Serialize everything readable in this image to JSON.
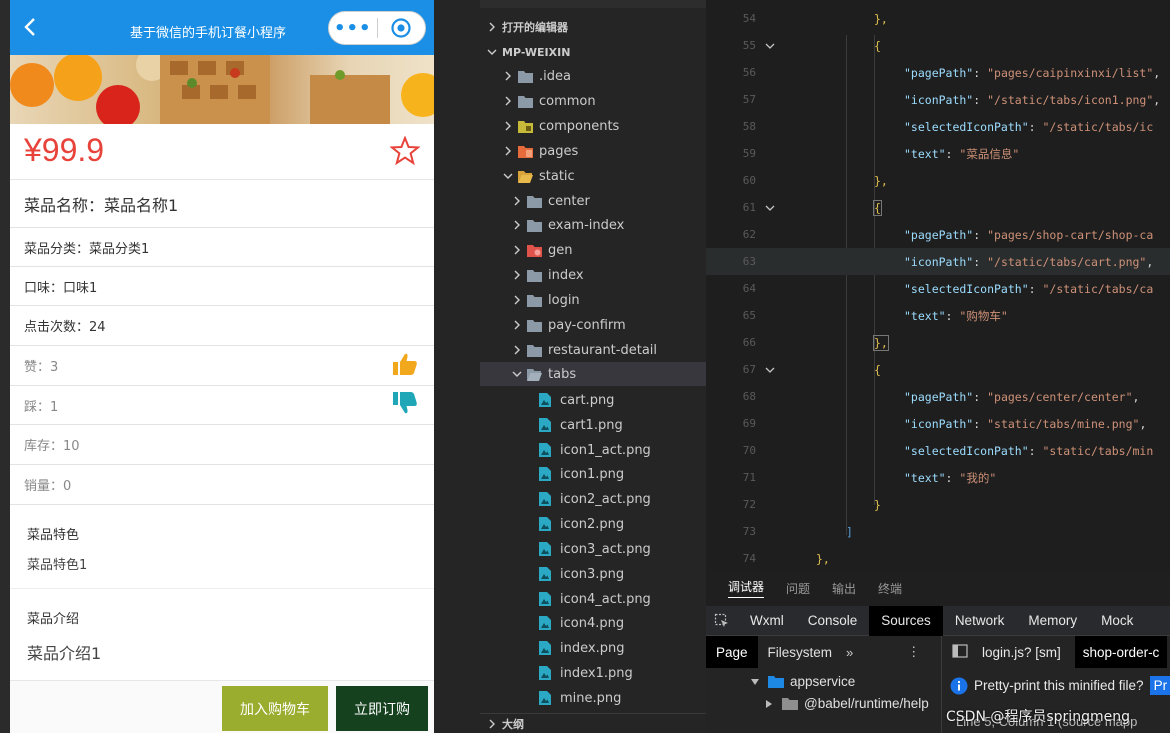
{
  "phone": {
    "title": "基于微信的手机订餐小程序",
    "capsule_more": "•••",
    "price": "¥99.9",
    "name_row": "菜品名称：菜品名称1",
    "rows": [
      {
        "label": "菜品分类：菜品分类1"
      },
      {
        "label": "口味：口味1"
      },
      {
        "label": "点击次数：24"
      },
      {
        "label": "赞：3"
      },
      {
        "label": "踩：1"
      },
      {
        "label": "库存：10"
      },
      {
        "label": "销量：0"
      }
    ],
    "feature_title": "菜品特色",
    "feature_text": "菜品特色1",
    "intro_title": "菜品介绍",
    "intro_text": "菜品介绍1",
    "add_cart": "加入购物车",
    "order_now": "立即订购"
  },
  "explorer": {
    "open_editors": "打开的编辑器",
    "project": "MP-WEIXIN",
    "folders": [
      ".idea",
      "common",
      "components",
      "pages",
      "static"
    ],
    "static_children": [
      "center",
      "exam-index",
      "gen",
      "index",
      "login",
      "pay-confirm",
      "restaurant-detail",
      "tabs"
    ],
    "tab_files": [
      "cart.png",
      "cart1.png",
      "icon1_act.png",
      "icon1.png",
      "icon2_act.png",
      "icon2.png",
      "icon3_act.png",
      "icon3.png",
      "icon4_act.png",
      "icon4.png",
      "index.png",
      "index1.png",
      "mine.png"
    ],
    "outline": "大纲"
  },
  "editor": {
    "line_numbers": [
      "54",
      "55",
      "56",
      "57",
      "58",
      "59",
      "60",
      "61",
      "62",
      "63",
      "64",
      "65",
      "66",
      "67",
      "68",
      "69",
      "70",
      "71",
      "72",
      "73",
      "74"
    ],
    "open_brace": "{",
    "close_brace_comma": "},",
    "close_brace": "}",
    "close_bracket": "]",
    "keys": {
      "pagePath": "\"pagePath\"",
      "iconPath": "\"iconPath\"",
      "selectedIconPath": "\"selectedIconPath\"",
      "text": "\"text\""
    },
    "colon": ": ",
    "comma": ",",
    "entries": [
      {
        "pagePath": "\"pages/caipinxinxi/list\"",
        "iconPath": "\"/static/tabs/icon1.png\"",
        "selectedIconPath": "\"/static/tabs/ic",
        "text": "\"菜品信息\""
      },
      {
        "pagePath": "\"pages/shop-cart/shop-ca",
        "iconPath": "\"/static/tabs/cart.png\"",
        "selectedIconPath": "\"/static/tabs/ca",
        "text": "\"购物车\""
      },
      {
        "pagePath": "\"pages/center/center\"",
        "iconPath": "\"static/tabs/mine.png\"",
        "selectedIconPath": "\"static/tabs/min",
        "text": "\"我的\""
      }
    ]
  },
  "devtools": {
    "tabs": [
      "调试器",
      "问题",
      "输出",
      "终端"
    ],
    "panels": [
      "Wxml",
      "Console",
      "Sources",
      "Network",
      "Memory",
      "Mock"
    ],
    "sub_tabs": [
      "Page",
      "Filesystem"
    ],
    "more": "»",
    "menu": "⋮",
    "file_tabs": [
      "login.js? [sm]",
      "shop-order-c"
    ],
    "tree": [
      "appservice",
      "@babel/runtime/help"
    ],
    "notice": "Pretty-print this minified file?",
    "notice_btn": "Pr",
    "status": "Line 5, Column 1  (source mapp"
  },
  "watermark": "CSDN @程序员springmeng",
  "colors": {
    "navbar": "#1a8fe5",
    "price": "#e8433a",
    "cart_btn": "#9aad2f",
    "order_btn": "#15411f",
    "editor_bg": "#1e1e1e"
  }
}
